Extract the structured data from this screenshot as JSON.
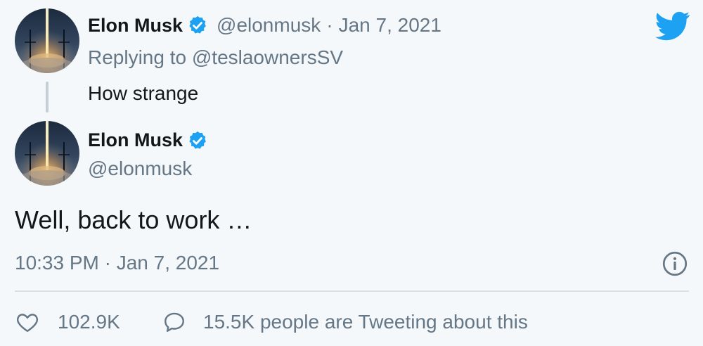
{
  "reply_tweet": {
    "author": {
      "display_name": "Elon Musk",
      "handle": "@elonmusk",
      "verified": true
    },
    "date": "Jan 7, 2021",
    "separator": "·",
    "replying_to": "Replying to @teslaownersSV",
    "text": "How strange"
  },
  "main_tweet": {
    "author": {
      "display_name": "Elon Musk",
      "handle": "@elonmusk",
      "verified": true
    },
    "text": "Well, back to work …",
    "timestamp": "10:33 PM · Jan 7, 2021"
  },
  "actions": {
    "likes": "102.9K",
    "tweeting": "15.5K people are Tweeting about this"
  },
  "colors": {
    "background": "#f5f8fa",
    "twitter_blue": "#1da1f2",
    "text": "#14171a",
    "muted": "#657786"
  },
  "icons": {
    "brand": "twitter-bird-icon",
    "verified": "verified-badge-icon",
    "info": "info-icon",
    "like": "heart-icon",
    "reply": "speech-bubble-icon"
  }
}
